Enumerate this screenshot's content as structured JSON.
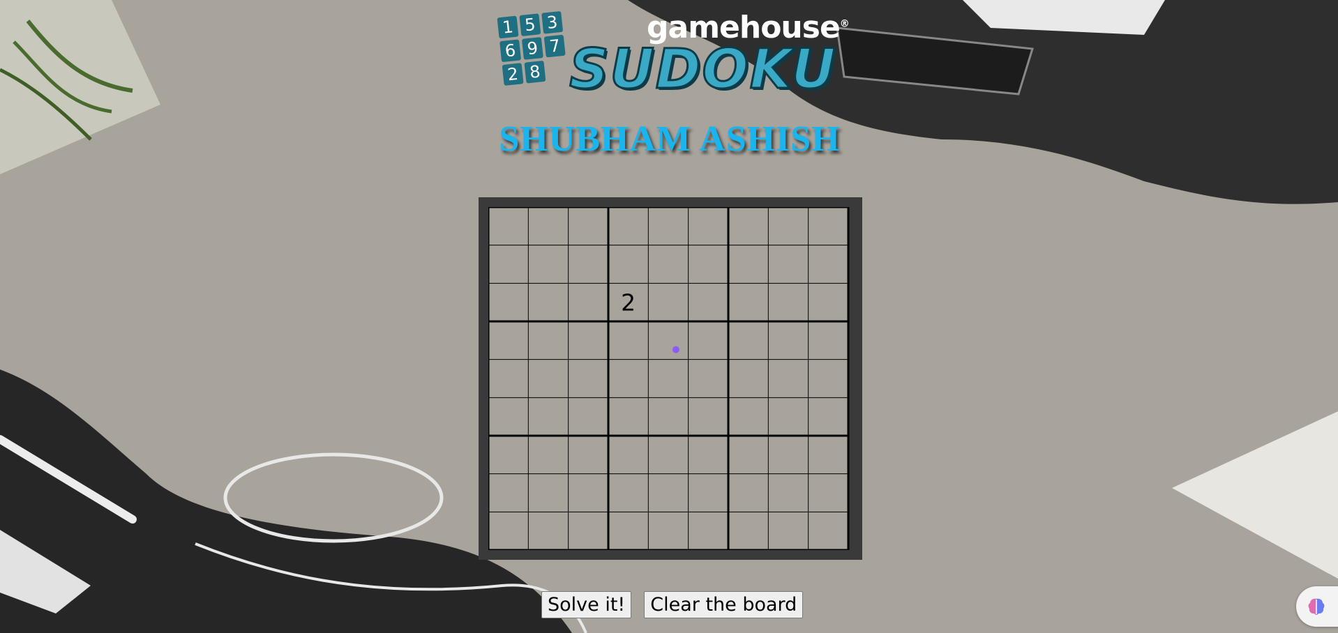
{
  "logo": {
    "brand": "gamehouse",
    "brand_mark": "®",
    "word": "SUDOKU",
    "tiles": [
      "1",
      "5",
      "3",
      "6",
      "9",
      "7",
      "2",
      "8"
    ]
  },
  "title": "SHUBHAM ASHISH",
  "board": {
    "size": 9,
    "cells": [
      [
        "",
        "",
        "",
        "",
        "",
        "",
        "",
        "",
        ""
      ],
      [
        "",
        "",
        "",
        "",
        "",
        "",
        "",
        "",
        ""
      ],
      [
        "",
        "",
        "",
        "2",
        "",
        "",
        "",
        "",
        ""
      ],
      [
        "",
        "",
        "",
        "",
        "",
        "",
        "",
        "",
        ""
      ],
      [
        "",
        "",
        "",
        "",
        "",
        "",
        "",
        "",
        ""
      ],
      [
        "",
        "",
        "",
        "",
        "",
        "",
        "",
        "",
        ""
      ],
      [
        "",
        "",
        "",
        "",
        "",
        "",
        "",
        "",
        ""
      ],
      [
        "",
        "",
        "",
        "",
        "",
        "",
        "",
        "",
        ""
      ],
      [
        "",
        "",
        "",
        "",
        "",
        "",
        "",
        "",
        ""
      ]
    ]
  },
  "buttons": {
    "solve_label": "Solve it!",
    "clear_label": "Clear the board"
  },
  "colors": {
    "title": "#19b5ef",
    "board_frame": "#3a3a3a",
    "board_bg": "#a8a39b",
    "cursor_dot": "#8b5cf6"
  },
  "icons": {
    "assistant": "brain-icon"
  }
}
